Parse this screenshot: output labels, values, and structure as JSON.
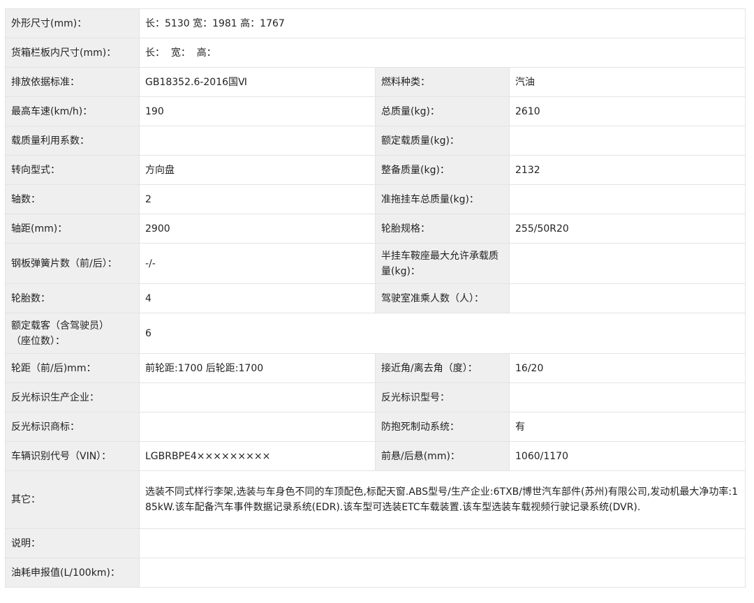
{
  "rows": [
    {
      "label": "外形尺寸(mm)：",
      "value": "长：5130 宽：1981 高：1767"
    },
    {
      "label": "货箱栏板内尺寸(mm)：",
      "value": "长：  宽：  高："
    },
    {
      "label": "排放依据标准：",
      "value": "GB18352.6-2016国Ⅵ",
      "label2": "燃料种类：",
      "value2": "汽油"
    },
    {
      "label": "最高车速(km/h)：",
      "value": "190",
      "label2": "总质量(kg)：",
      "value2": "2610"
    },
    {
      "label": "载质量利用系数：",
      "value": "",
      "label2": "额定载质量(kg)：",
      "value2": ""
    },
    {
      "label": "转向型式：",
      "value": "方向盘",
      "label2": "整备质量(kg)：",
      "value2": "2132"
    },
    {
      "label": "轴数：",
      "value": "2",
      "label2": "准拖挂车总质量(kg)：",
      "value2": ""
    },
    {
      "label": "轴距(mm)：",
      "value": "2900",
      "label2": "轮胎规格：",
      "value2": "255/50R20"
    },
    {
      "label": "钢板弹簧片数（前/后）：",
      "value": "-/-",
      "label2": "半挂车鞍座最大允许承载质量(kg)：",
      "value2": ""
    },
    {
      "label": "轮胎数：",
      "value": "4",
      "label2": "驾驶室准乘人数（人）：",
      "value2": ""
    },
    {
      "label": "额定载客（含驾驶员）（座位数）：",
      "value": "6"
    },
    {
      "label": "轮距（前/后)mm：",
      "value": "前轮距:1700 后轮距:1700",
      "label2": "接近角/离去角（度）：",
      "value2": "16/20"
    },
    {
      "label": "反光标识生产企业：",
      "value": "",
      "label2": "反光标识型号：",
      "value2": ""
    },
    {
      "label": "反光标识商标：",
      "value": "",
      "label2": "防抱死制动系统：",
      "value2": "有"
    },
    {
      "label": "车辆识别代号（VIN）：",
      "value": "LGBRBPE4×××××××××",
      "label2": "前悬/后悬(mm)：",
      "value2": "1060/1170"
    },
    {
      "label": "其它：",
      "value": "选装不同式样行李架,选装与车身色不同的车顶配色,标配天窗.ABS型号/生产企业:6TXB/博世汽车部件(苏州)有限公司,发动机最大净功率:185kW.该车配备汽车事件数据记录系统(EDR).该车型可选装ETC车载装置.该车型选装车载视频行驶记录系统(DVR)."
    },
    {
      "label": "说明：",
      "value": ""
    },
    {
      "label": "油耗申报值(L/100km)：",
      "value": ""
    }
  ]
}
